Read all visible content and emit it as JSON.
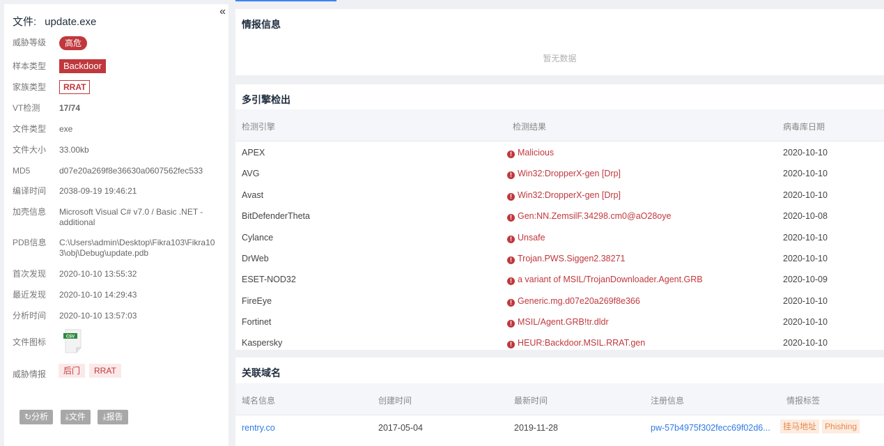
{
  "left": {
    "collapse_icon": "«",
    "file_label": "文件:",
    "file_name": "update.exe",
    "threat_level_label": "威胁等级",
    "threat_level": "高危",
    "sample_type_label": "样本类型",
    "sample_type": "Backdoor",
    "family_label": "家族类型",
    "family": "RRAT",
    "vt_label": "VT检测",
    "vt": "17/74",
    "file_type_label": "文件类型",
    "file_type": "exe",
    "file_size_label": "文件大小",
    "file_size": "33.00kb",
    "md5_label": "MD5",
    "md5": "d07e20a269f8e36630a0607562fec533",
    "compile_time_label": "编译时间",
    "compile_time": "2038-09-19 19:46:21",
    "packer_label": "加壳信息",
    "packer": "Microsoft Visual C# v7.0 / Basic .NET - additional",
    "pdb_label": "PDB信息",
    "pdb": "C:\\Users\\admin\\Desktop\\Fikra103\\Fikra103\\obj\\Debug\\update.pdb",
    "first_seen_label": "首次发现",
    "first_seen": "2020-10-10 13:55:32",
    "last_seen_label": "最近发现",
    "last_seen": "2020-10-10 14:29:43",
    "analysis_time_label": "分析时间",
    "analysis_time": "2020-10-10 13:57:03",
    "icon_label": "文件图标",
    "icon_text": "CSV",
    "intel_label": "威胁情报",
    "intel_tags": [
      "后门",
      "RRAT"
    ],
    "buttons": {
      "analyze": "分析",
      "file": "文件",
      "report": "报告"
    }
  },
  "intel_card": {
    "title": "情报信息",
    "empty": "暂无数据"
  },
  "engines_card": {
    "title": "多引擎检出",
    "headers": [
      "检测引擎",
      "检测结果",
      "病毒库日期"
    ],
    "rows": [
      {
        "engine": "APEX",
        "result": "Malicious",
        "date": "2020-10-10"
      },
      {
        "engine": "AVG",
        "result": "Win32:DropperX-gen [Drp]",
        "date": "2020-10-10"
      },
      {
        "engine": "Avast",
        "result": "Win32:DropperX-gen [Drp]",
        "date": "2020-10-10"
      },
      {
        "engine": "BitDefenderTheta",
        "result": "Gen:NN.ZemsilF.34298.cm0@aO28oye",
        "date": "2020-10-08"
      },
      {
        "engine": "Cylance",
        "result": "Unsafe",
        "date": "2020-10-10"
      },
      {
        "engine": "DrWeb",
        "result": "Trojan.PWS.Siggen2.38271",
        "date": "2020-10-10"
      },
      {
        "engine": "ESET-NOD32",
        "result": "a variant of MSIL/TrojanDownloader.Agent.GRB",
        "date": "2020-10-09"
      },
      {
        "engine": "FireEye",
        "result": "Generic.mg.d07e20a269f8e366",
        "date": "2020-10-10"
      },
      {
        "engine": "Fortinet",
        "result": "MSIL/Agent.GRB!tr.dldr",
        "date": "2020-10-10"
      },
      {
        "engine": "Kaspersky",
        "result": "HEUR:Backdoor.MSIL.RRAT.gen",
        "date": "2020-10-10"
      }
    ]
  },
  "domains_card": {
    "title": "关联域名",
    "headers": [
      "域名信息",
      "创建时间",
      "最新时间",
      "注册信息",
      "情报标签"
    ],
    "rows": [
      {
        "domain": "rentry.co",
        "created": "2017-05-04",
        "updated": "2019-11-28",
        "registrar": "pw-57b4975f302fecc69f02d6...",
        "tags": [
          "挂马地址",
          "Phishing"
        ]
      }
    ]
  },
  "colors": {
    "danger": "#c0383d",
    "link": "#2f7ae5",
    "tag_orange": "#e58a4e"
  }
}
